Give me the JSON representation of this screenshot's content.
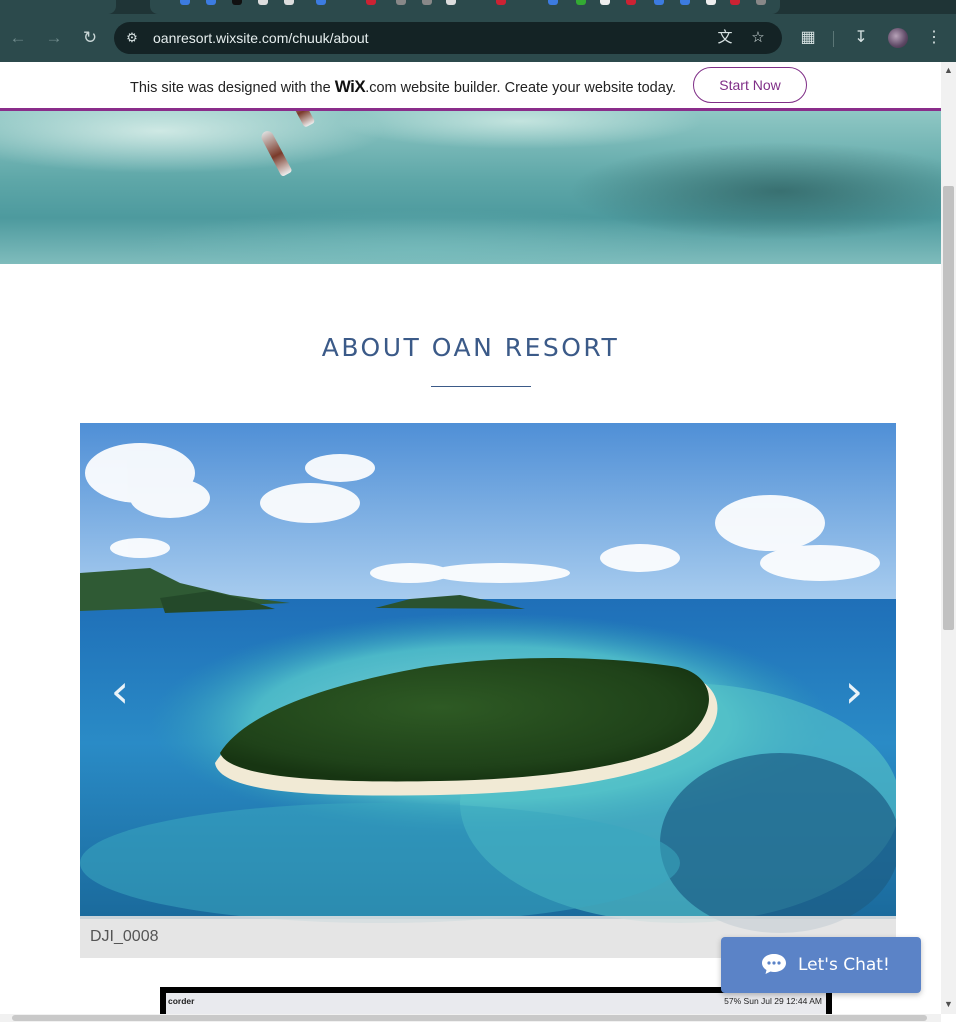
{
  "browser": {
    "url": "oanresort.wixsite.com/chuuk/about",
    "icons": {
      "back": "arrow-left-icon",
      "forward": "arrow-right-icon",
      "reload": "reload-icon",
      "site_info": "tune-icon",
      "translate": "translate-icon",
      "bookmark": "star-icon",
      "extensions": "puzzle-icon",
      "download": "download-icon",
      "menu": "kebab-menu-icon"
    }
  },
  "wix_banner": {
    "text_before": "This site was designed with the ",
    "logo": "WiX",
    "text_after": ".com website builder. Create your website today.",
    "button_label": "Start Now",
    "accent_color": "#7f2e87"
  },
  "about": {
    "title": "ABOUT OAN RESORT"
  },
  "gallery": {
    "caption": "DJI_0008",
    "prev_label": "‹",
    "next_label": "›"
  },
  "lower_image": {
    "left_text": "corder",
    "right_text": "57%   Sun Jul 29  12:44 AM"
  },
  "chat": {
    "label": "Let's Chat!",
    "color": "#5b83c7"
  }
}
